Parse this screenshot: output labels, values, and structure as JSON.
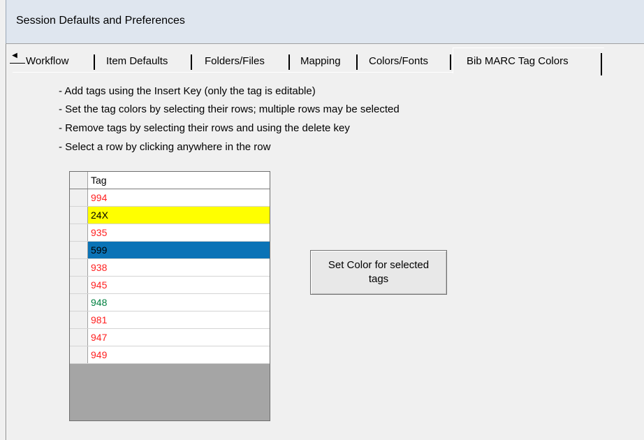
{
  "window": {
    "title": "Session Defaults and Preferences"
  },
  "tabs": [
    {
      "label": "Workflow",
      "active": false
    },
    {
      "label": "Item Defaults",
      "active": false
    },
    {
      "label": "Folders/Files",
      "active": false
    },
    {
      "label": "Mapping",
      "active": false
    },
    {
      "label": "Colors/Fonts",
      "active": false
    },
    {
      "label": "Bib MARC Tag Colors",
      "active": true
    }
  ],
  "instructions": [
    "- Add tags using the Insert Key (only the tag is editable)",
    "- Set the tag colors by selecting their rows; multiple rows may be selected",
    "- Remove tags by selecting their rows and using the delete key",
    "- Select a row by clicking anywhere in the row"
  ],
  "grid": {
    "header": "Tag",
    "rows": [
      {
        "tag": "994",
        "color": "#ff2020",
        "bg": "#ffffff"
      },
      {
        "tag": "24X",
        "color": "#000000",
        "bg": "#ffff00"
      },
      {
        "tag": "935",
        "color": "#ff2020",
        "bg": "#ffffff"
      },
      {
        "tag": "599",
        "color": "#000000",
        "bg": "#0a73b6"
      },
      {
        "tag": "938",
        "color": "#ff2020",
        "bg": "#ffffff"
      },
      {
        "tag": "945",
        "color": "#ff2020",
        "bg": "#ffffff"
      },
      {
        "tag": "948",
        "color": "#008040",
        "bg": "#ffffff"
      },
      {
        "tag": "981",
        "color": "#ff2020",
        "bg": "#ffffff"
      },
      {
        "tag": "947",
        "color": "#ff2020",
        "bg": "#ffffff"
      },
      {
        "tag": "949",
        "color": "#ff2020",
        "bg": "#ffffff"
      }
    ]
  },
  "button": {
    "line1": "Set Color for selected",
    "line2": "tags"
  }
}
